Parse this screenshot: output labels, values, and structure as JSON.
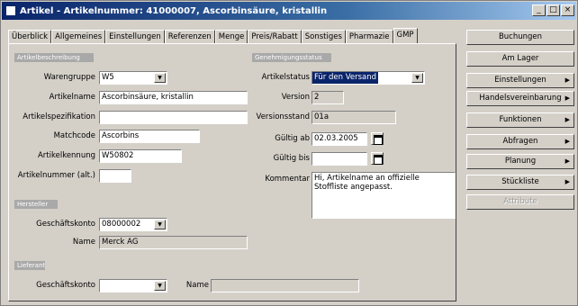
{
  "window": {
    "title": "Artikel - Artikelnummer: 41000007, Ascorbinsäure, kristallin"
  },
  "tabs": [
    "Überblick",
    "Allgemeines",
    "Einstellungen",
    "Referenzen",
    "Menge",
    "Preis/Rabatt",
    "Sonstiges",
    "Pharmazie",
    "GMP"
  ],
  "active_tab": "GMP",
  "sections": {
    "article": "Artikelbeschreibung",
    "approval": "Genehmigungsstatus",
    "manufacturer": "Hersteller",
    "supplier": "Lieferant"
  },
  "form": {
    "warengruppe": {
      "label": "Warengruppe",
      "value": "W5"
    },
    "artikelname": {
      "label": "Artikelname",
      "value": "Ascorbinsäure, kristallin"
    },
    "artikelspezifikation": {
      "label": "Artikelspezifikation",
      "value": ""
    },
    "matchcode": {
      "label": "Matchcode",
      "value": "Ascorbins"
    },
    "artikelkennung": {
      "label": "Artikelkennung",
      "value": "W50802"
    },
    "artikelnummer_alt": {
      "label": "Artikelnummer (alt.)",
      "value": ""
    },
    "artikelstatus": {
      "label": "Artikelstatus",
      "value": "Für den Versand"
    },
    "version": {
      "label": "Version",
      "value": "2"
    },
    "versionsstand": {
      "label": "Versionsstand",
      "value": "01a"
    },
    "gueltig_ab": {
      "label": "Gültig ab",
      "value": "02.03.2005"
    },
    "gueltig_bis": {
      "label": "Gültig bis",
      "value": ""
    },
    "kommentar": {
      "label": "Kommentar",
      "value": "Hi, Artikelname an offizielle Stoffliste angepasst."
    },
    "hersteller_geschaeftskonto": {
      "label": "Geschäftskonto",
      "value": "08000002"
    },
    "hersteller_name": {
      "label": "Name",
      "value": "Merck AG"
    },
    "lieferant_geschaeftskonto": {
      "label": "Geschäftskonto",
      "value": ""
    },
    "lieferant_name": {
      "label": "Name",
      "value": ""
    }
  },
  "sidebar": [
    {
      "label": "Buchungen",
      "arrow": false,
      "enabled": true
    },
    {
      "label": "Am Lager",
      "arrow": false,
      "enabled": true
    },
    {
      "label": "Einstellungen",
      "arrow": true,
      "enabled": true
    },
    {
      "label": "Handelsvereinbarung",
      "arrow": true,
      "enabled": true
    },
    {
      "label": "Funktionen",
      "arrow": true,
      "enabled": true
    },
    {
      "label": "Abfragen",
      "arrow": true,
      "enabled": true
    },
    {
      "label": "Planung",
      "arrow": true,
      "enabled": true
    },
    {
      "label": "Stückliste",
      "arrow": true,
      "enabled": true
    },
    {
      "label": "Attribute",
      "arrow": false,
      "enabled": false
    }
  ]
}
